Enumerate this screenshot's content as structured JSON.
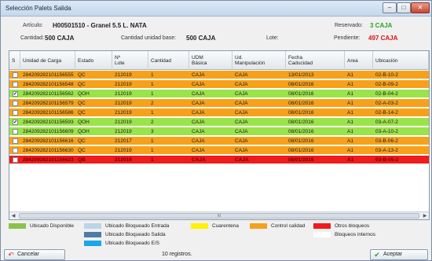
{
  "window": {
    "title": "Selección Palets Salida"
  },
  "header": {
    "articulo_label": "Artículo:",
    "articulo_value": "H00501510 - Granel 5.5 L. NATA",
    "reservado_label": "Reservado:",
    "reservado_value": "3 CAJA",
    "cantidad_label": "Cantidad:",
    "cantidad_value": "500 CAJA",
    "cantidad_base_label": "Cantidad unidad base:",
    "cantidad_base_value": "500 CAJA",
    "lote_label": "Lote:",
    "pendiente_label": "Pendiente:",
    "pendiente_value": "497 CAJA"
  },
  "table": {
    "columns": [
      "S",
      "Unidad de Carga",
      "Estado",
      "Nº\nLote",
      "Cantidad",
      "UDM\nBásica",
      "Ud.\nManipulación",
      "Fecha\nCaducidad",
      "Area",
      "Ubicación"
    ],
    "rows": [
      {
        "checked": false,
        "unidad": "284209282101156555",
        "estado": "QC",
        "lote": "212019",
        "cantidad": "1",
        "udm": "CAJA",
        "manip": "CAJA",
        "fecha": "13/01/2013",
        "area": "A1",
        "ubicacion": "02-B-10-2",
        "color": "#f7a11a"
      },
      {
        "checked": false,
        "unidad": "284209282101156548",
        "estado": "QC",
        "lote": "212019",
        "cantidad": "1",
        "udm": "CAJA",
        "manip": "CAJA",
        "fecha": "08/01/2016",
        "area": "A1",
        "ubicacion": "02-B-09-2",
        "color": "#f7a11a"
      },
      {
        "checked": true,
        "unidad": "284209282101156562",
        "estado": "QOH",
        "lote": "212019",
        "cantidad": "1",
        "udm": "CAJA",
        "manip": "CAJA",
        "fecha": "08/01/2016",
        "area": "A1",
        "ubicacion": "02-B-04-2",
        "color": "#9be34a"
      },
      {
        "checked": false,
        "unidad": "284209282101156579",
        "estado": "QC",
        "lote": "212019",
        "cantidad": "2",
        "udm": "CAJA",
        "manip": "CAJA",
        "fecha": "08/01/2016",
        "area": "A1",
        "ubicacion": "02-A-03-2",
        "color": "#f7a11a"
      },
      {
        "checked": false,
        "unidad": "284209282101156586",
        "estado": "QC",
        "lote": "212019",
        "cantidad": "1",
        "udm": "CAJA",
        "manip": "CAJA",
        "fecha": "08/01/2016",
        "area": "A1",
        "ubicacion": "02-B-14-2",
        "color": "#f7a11a"
      },
      {
        "checked": true,
        "unidad": "284209282101156593",
        "estado": "QOH",
        "lote": "212019",
        "cantidad": "2",
        "udm": "CAJA",
        "manip": "CAJA",
        "fecha": "08/01/2016",
        "area": "A1",
        "ubicacion": "03-A-07-2",
        "color": "#9be34a"
      },
      {
        "checked": false,
        "unidad": "284209282101156609",
        "estado": "QOH",
        "lote": "212019",
        "cantidad": "3",
        "udm": "CAJA",
        "manip": "CAJA",
        "fecha": "08/01/2016",
        "area": "A1",
        "ubicacion": "03-A-10-2",
        "color": "#9be34a"
      },
      {
        "checked": false,
        "unidad": "284209282101156616",
        "estado": "QC",
        "lote": "212017",
        "cantidad": "1",
        "udm": "CAJA",
        "manip": "CAJA",
        "fecha": "08/01/2016",
        "area": "A1",
        "ubicacion": "03-B-06-2",
        "color": "#f7a11a"
      },
      {
        "checked": false,
        "unidad": "284209282101156630",
        "estado": "QC",
        "lote": "212019",
        "cantidad": "1",
        "udm": "CAJA",
        "manip": "CAJA",
        "fecha": "08/01/2016",
        "area": "A1",
        "ubicacion": "03-A-13-2",
        "color": "#f7a11a"
      },
      {
        "checked": false,
        "unidad": "284209282101156623",
        "estado": "QB",
        "lote": "212019",
        "cantidad": "1",
        "udm": "CAJA",
        "manip": "CAJA",
        "fecha": "08/01/2016",
        "area": "A1",
        "ubicacion": "03-B-05-2",
        "color": "#ee1c1c"
      }
    ],
    "scroll_thumb_label": "III"
  },
  "legend": [
    {
      "label": "Ubicado Disponible",
      "color": "#8bc34a"
    },
    {
      "label": "Ubicado Bloqueado Entrada",
      "color": "#b9d6e8"
    },
    {
      "label": "Ubicado Bloqueado Salida",
      "color": "#4f7aa6"
    },
    {
      "label": "Ubicado Bloqueado E/S",
      "color": "#1aa6e8"
    },
    {
      "label": "Cuarentena",
      "color": "#fff200"
    },
    {
      "label": "Control calidad",
      "color": "#f7a11a"
    },
    {
      "label": "Otros bloqueos",
      "color": "#ee1c1c"
    },
    {
      "label": "Bloqueos internos",
      "color": "#ffffff"
    }
  ],
  "footer": {
    "cancel_label": "Cancelar",
    "accept_label": "Aceptar",
    "status_text": "10 registros."
  }
}
